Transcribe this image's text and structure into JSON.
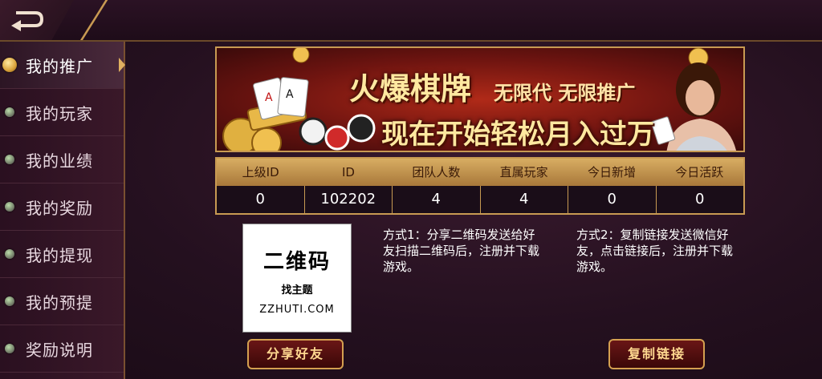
{
  "sidebar": {
    "items": [
      {
        "label": "我的推广",
        "active": true
      },
      {
        "label": "我的玩家",
        "active": false
      },
      {
        "label": "我的业绩",
        "active": false
      },
      {
        "label": "我的奖励",
        "active": false
      },
      {
        "label": "我的提现",
        "active": false
      },
      {
        "label": "我的预提",
        "active": false
      },
      {
        "label": "奖励说明",
        "active": false
      }
    ]
  },
  "banner": {
    "title_main": "火爆棋牌",
    "title_sub": "无限代 无限推广",
    "title_line2": "现在开始轻松月入过万"
  },
  "stats": {
    "headers": [
      "上级ID",
      "ID",
      "团队人数",
      "直属玩家",
      "今日新增",
      "今日活跃"
    ],
    "values": [
      "0",
      "102202",
      "4",
      "4",
      "0",
      "0"
    ]
  },
  "qr": {
    "title": "二维码",
    "brand": "找主题",
    "url": "ZZHUTI.COM"
  },
  "method1": "方式1：分享二维码发送给好友扫描二维码后，注册并下载游戏。",
  "method2": "方式2：复制链接发送微信好友，点击链接后，注册并下载游戏。",
  "buttons": {
    "share": "分享好友",
    "copy": "复制链接"
  },
  "colors": {
    "gold": "#c89a52",
    "button_bg": "#5a1010",
    "background": "#2a1222"
  }
}
